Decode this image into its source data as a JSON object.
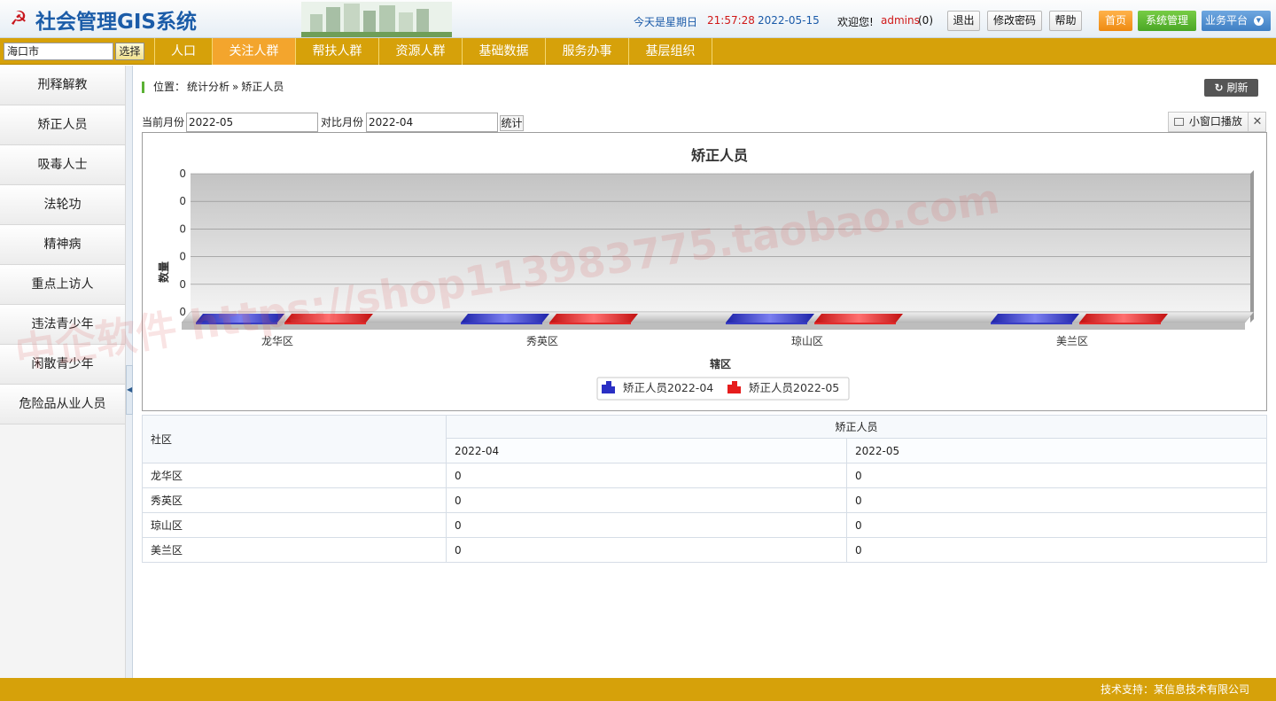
{
  "header": {
    "title": "社会管理GIS系统",
    "weekday": "今天是星期日",
    "time": "21:57:28",
    "date": "2022-05-15",
    "welcome": "欢迎您!",
    "user": "admins",
    "count": "(0)",
    "logout": "退出",
    "change_password": "修改密码",
    "help": "帮助",
    "home": "首页",
    "system": "系统管理",
    "business": "业务平台"
  },
  "nav": {
    "city": "海口市",
    "select": "选择",
    "tabs": [
      "人口",
      "关注人群",
      "帮扶人群",
      "资源人群",
      "基础数据",
      "服务办事",
      "基层组织"
    ],
    "active": "关注人群"
  },
  "sidebar": {
    "items": [
      "刑释解教",
      "矫正人员",
      "吸毒人士",
      "法轮功",
      "精神病",
      "重点上访人",
      "违法青少年",
      "闲散青少年",
      "危险品从业人员"
    ]
  },
  "breadcrumb": {
    "label": "位置：",
    "path": "统计分析",
    "sep": "»",
    "current": "矫正人员"
  },
  "refresh": "刷新",
  "filter": {
    "current_label": "当前月份",
    "current_value": "2022-05",
    "compare_label": "对比月份",
    "compare_value": "2022-04",
    "submit": "统计",
    "popout": "小窗口播放"
  },
  "chart_data": {
    "type": "bar",
    "title": "矫正人员",
    "xlabel": "辖区",
    "ylabel": "数量",
    "categories": [
      "龙华区",
      "秀英区",
      "琼山区",
      "美兰区"
    ],
    "series": [
      {
        "name": "矫正人员2022-04",
        "values": [
          0,
          0,
          0,
          0
        ],
        "color": "#2a2fc4"
      },
      {
        "name": "矫正人员2022-05",
        "values": [
          0,
          0,
          0,
          0
        ],
        "color": "#e61c1c"
      }
    ],
    "yticks": [
      "0",
      "0",
      "0",
      "0",
      "0",
      "0"
    ],
    "legend": "bottom-center",
    "grid": true
  },
  "table": {
    "col_header": "社区",
    "group_header": "矫正人员",
    "months": [
      "2022-04",
      "2022-05"
    ],
    "rows": [
      {
        "name": "龙华区",
        "v1": "0",
        "v2": "0"
      },
      {
        "name": "秀英区",
        "v1": "0",
        "v2": "0"
      },
      {
        "name": "琼山区",
        "v1": "0",
        "v2": "0"
      },
      {
        "name": "美兰区",
        "v1": "0",
        "v2": "0"
      }
    ]
  },
  "watermark": "中企软件 https://shop113983775.taobao.com",
  "footer": "技术支持：某信息技术有限公司"
}
